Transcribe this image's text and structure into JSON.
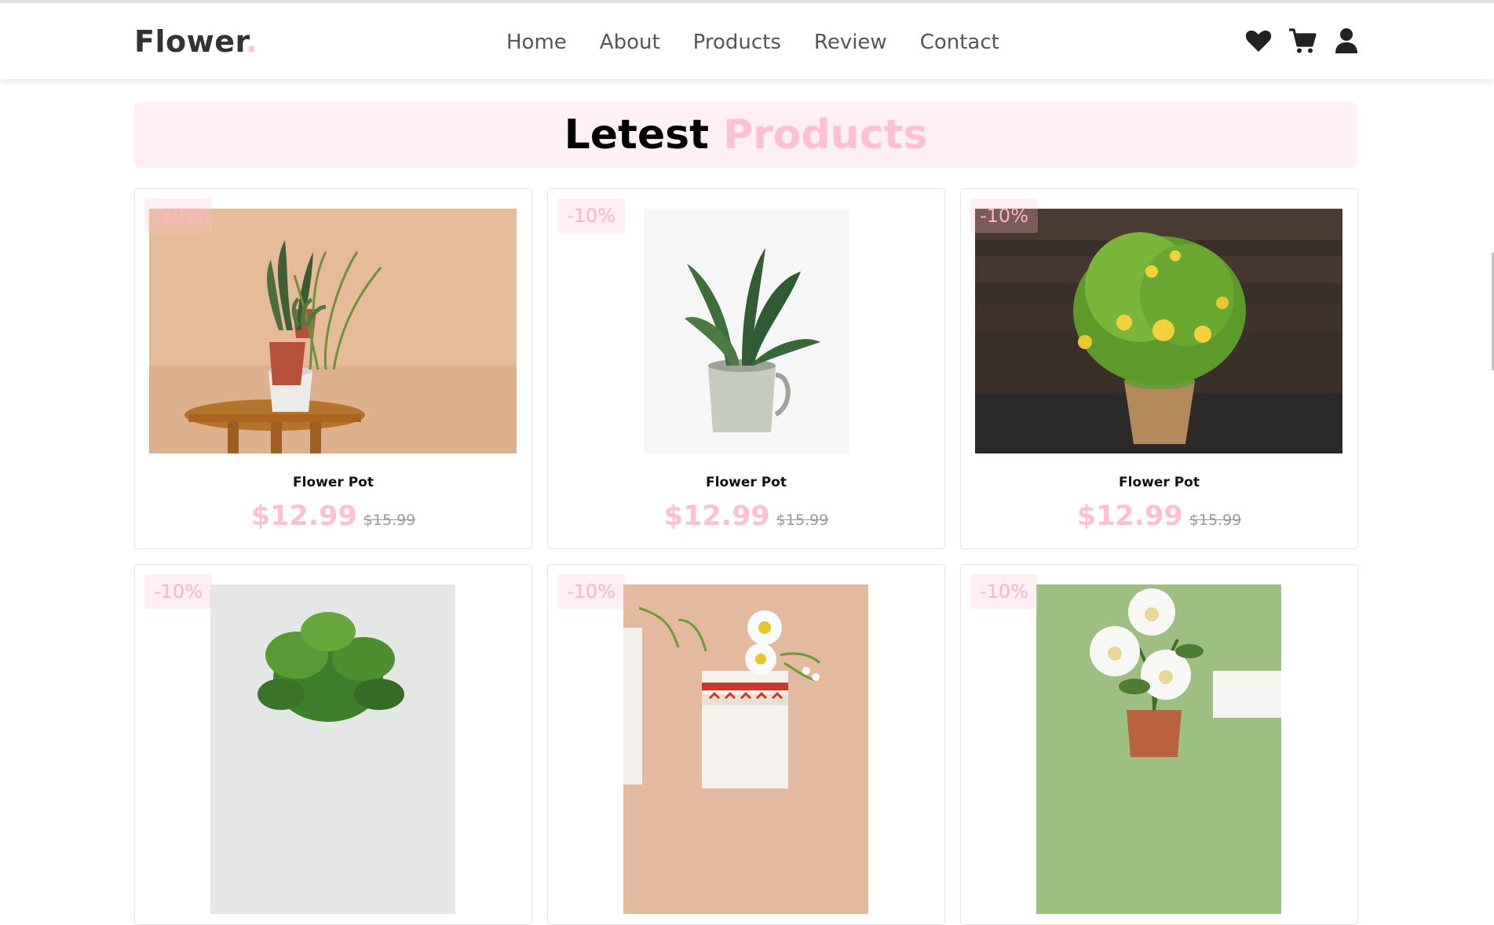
{
  "header": {
    "logo_text": "Flower",
    "logo_dot": ".",
    "nav": [
      "Home",
      "About",
      "Products",
      "Review",
      "Contact"
    ],
    "icons": [
      "heart-icon",
      "cart-icon",
      "user-icon"
    ]
  },
  "section": {
    "title_main": "Letest",
    "title_accent": "Products"
  },
  "colors": {
    "accent": "#ffc1d1",
    "banner_bg": "#fff0f4"
  },
  "products": [
    {
      "badge": "-10%",
      "name": "Flower Pot",
      "price": "$12.99",
      "old_price": "$15.99",
      "image": "three-plants-on-wooden-stool"
    },
    {
      "badge": "-10%",
      "name": "Flower Pot",
      "price": "$12.99",
      "old_price": "$15.99",
      "image": "plant-in-metal-mug"
    },
    {
      "badge": "-10%",
      "name": "Flower Pot",
      "price": "$12.99",
      "old_price": "$15.99",
      "image": "yellow-flowers-in-pot"
    },
    {
      "badge": "-10%",
      "name": "",
      "price": "",
      "old_price": "",
      "image": "green-leafy-plant"
    },
    {
      "badge": "-10%",
      "name": "",
      "price": "",
      "old_price": "",
      "image": "white-daisies-in-patterned-vase"
    },
    {
      "badge": "-10%",
      "name": "",
      "price": "",
      "old_price": "",
      "image": "white-peonies-on-green"
    }
  ]
}
